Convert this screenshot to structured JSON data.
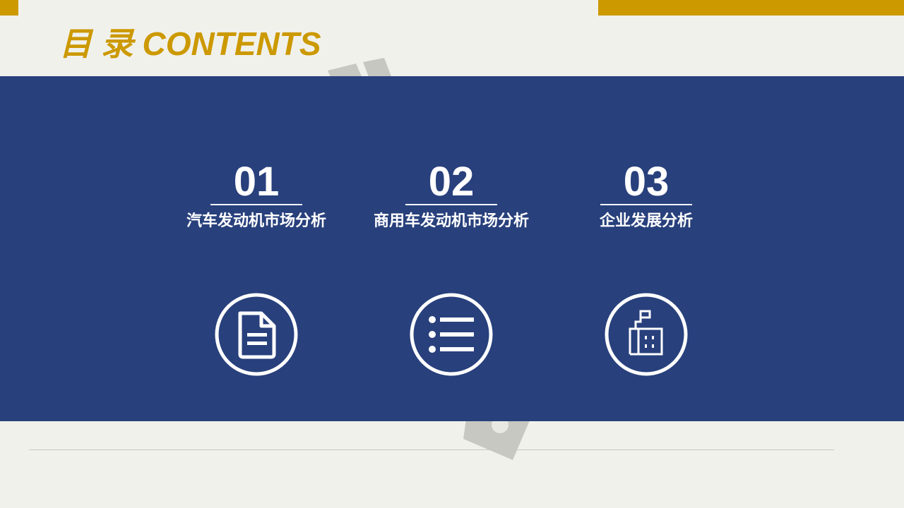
{
  "header": {
    "title": "目 录 CONTENTS"
  },
  "colors": {
    "accent_gold": "#cc9900",
    "panel_blue": "#28407c",
    "background": "#f1f1ec",
    "foreground": "#ffffff"
  },
  "items": [
    {
      "number": "01",
      "title": "汽车发动机市场分析",
      "icon": "document-icon"
    },
    {
      "number": "02",
      "title": "商用车发动机市场分析",
      "icon": "list-icon"
    },
    {
      "number": "03",
      "title": "企业发展分析",
      "icon": "building-icon"
    }
  ]
}
